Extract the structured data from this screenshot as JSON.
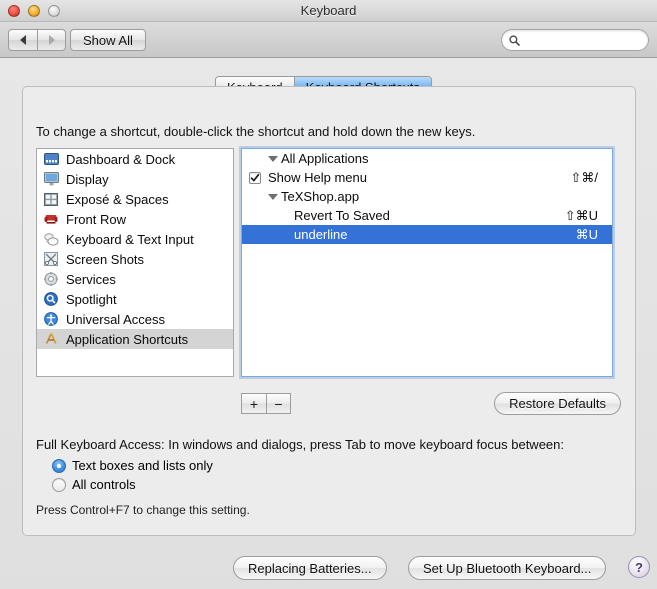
{
  "window": {
    "title": "Keyboard",
    "traffic_lights": [
      "close-button",
      "minimize-button",
      "zoom-button"
    ]
  },
  "toolbar": {
    "back_label": "◀",
    "forward_label": "▶",
    "show_all_label": "Show All",
    "search": {
      "value": "",
      "placeholder": ""
    }
  },
  "tabs": [
    {
      "label": "Keyboard",
      "active": false
    },
    {
      "label": "Keyboard Shortcuts",
      "active": true
    }
  ],
  "main": {
    "instructions": "To change a shortcut, double-click the shortcut and hold down the new keys."
  },
  "sidebar": {
    "items": [
      {
        "label": "Dashboard & Dock",
        "icon": "dashboard-dock-icon",
        "selected": false
      },
      {
        "label": "Display",
        "icon": "display-icon",
        "selected": false
      },
      {
        "label": "Exposé & Spaces",
        "icon": "expose-spaces-icon",
        "selected": false
      },
      {
        "label": "Front Row",
        "icon": "front-row-icon",
        "selected": false
      },
      {
        "label": "Keyboard & Text Input",
        "icon": "keyboard-text-icon",
        "selected": false
      },
      {
        "label": "Screen Shots",
        "icon": "screen-shots-icon",
        "selected": false
      },
      {
        "label": "Services",
        "icon": "services-gear-icon",
        "selected": false
      },
      {
        "label": "Spotlight",
        "icon": "spotlight-icon",
        "selected": false
      },
      {
        "label": "Universal Access",
        "icon": "universal-access-icon",
        "selected": false
      },
      {
        "label": "Application Shortcuts",
        "icon": "application-shortcuts-icon",
        "selected": true
      }
    ]
  },
  "shortcuts": {
    "rows": [
      {
        "type": "group",
        "label": "All Applications",
        "expanded": true,
        "shortcut": "",
        "checkbox": null,
        "selected": false
      },
      {
        "type": "item",
        "label": "Show Help menu",
        "expanded": null,
        "shortcut": "⇧⌘/",
        "checkbox": true,
        "selected": false
      },
      {
        "type": "group",
        "label": "TeXShop.app",
        "expanded": true,
        "shortcut": "",
        "checkbox": null,
        "selected": false
      },
      {
        "type": "item",
        "label": "Revert To Saved",
        "expanded": null,
        "shortcut": "⇧⌘U",
        "checkbox": null,
        "selected": false
      },
      {
        "type": "item",
        "label": "underline",
        "expanded": null,
        "shortcut": "⌘U",
        "checkbox": null,
        "selected": true
      }
    ],
    "add_label": "+",
    "remove_label": "−",
    "restore_defaults_label": "Restore Defaults"
  },
  "full_keyboard_access": {
    "label": "Full Keyboard Access: In windows and dialogs, press Tab to move keyboard focus between:",
    "options": [
      {
        "label": "Text boxes and lists only",
        "selected": true
      },
      {
        "label": "All controls",
        "selected": false
      }
    ],
    "hint": "Press Control+F7 to change this setting."
  },
  "footer": {
    "replacing_batteries_label": "Replacing Batteries...",
    "bluetooth_label": "Set Up Bluetooth Keyboard...",
    "help_label": "?"
  },
  "colors": {
    "selection_blue": "#3572d8",
    "tab_active_blue": "#7bb8ef",
    "inactive_selection_gray": "#d4d4d4",
    "window_bg": "#ececec"
  }
}
